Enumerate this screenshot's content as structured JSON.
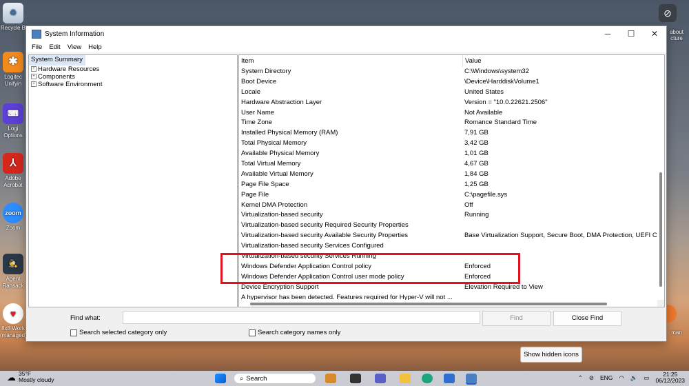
{
  "desktop": {
    "left_icons": [
      "Recycle B",
      "Logitec Unifyin",
      "Logi Options",
      "Adobe Acrobat",
      "Zoom",
      "Agent Ransack",
      "8x8 Work (managed)"
    ],
    "right_labels": [
      "about cture",
      "man"
    ],
    "zoom_icon_text": "zoom"
  },
  "window": {
    "title": "System Information",
    "controls": {
      "minimize": "─",
      "maximize": "☐",
      "close": "✕"
    },
    "menu": [
      "File",
      "Edit",
      "View",
      "Help"
    ],
    "tree": {
      "root": "System Summary",
      "children": [
        "Hardware Resources",
        "Components",
        "Software Environment"
      ]
    },
    "table": {
      "headers": {
        "item": "Item",
        "value": "Value"
      },
      "rows": [
        {
          "item": "System Directory",
          "value": "C:\\Windows\\system32"
        },
        {
          "item": "Boot Device",
          "value": "\\Device\\HarddiskVolume1"
        },
        {
          "item": "Locale",
          "value": "United States"
        },
        {
          "item": "Hardware Abstraction Layer",
          "value": "Version = \"10.0.22621.2506\""
        },
        {
          "item": "User Name",
          "value": "Not Available"
        },
        {
          "item": "Time Zone",
          "value": "Romance Standard Time"
        },
        {
          "item": "Installed Physical Memory (RAM)",
          "value": "7,91 GB"
        },
        {
          "item": "Total Physical Memory",
          "value": "3,42 GB"
        },
        {
          "item": "Available Physical Memory",
          "value": "1,01 GB"
        },
        {
          "item": "Total Virtual Memory",
          "value": "4,67 GB"
        },
        {
          "item": "Available Virtual Memory",
          "value": "1,84 GB"
        },
        {
          "item": "Page File Space",
          "value": "1,25 GB"
        },
        {
          "item": "Page File",
          "value": "C:\\pagefile.sys"
        },
        {
          "item": "Kernel DMA Protection",
          "value": "Off"
        },
        {
          "item": "Virtualization-based security",
          "value": "Running"
        },
        {
          "item": "Virtualization-based security Required Security Properties",
          "value": ""
        },
        {
          "item": "Virtualization-based security Available Security Properties",
          "value": "Base Virtualization Support, Secure Boot, DMA Protection, UEFI Co"
        },
        {
          "item": "Virtualization-based security Services Configured",
          "value": ""
        },
        {
          "item": "Virtualization-based security Services Running",
          "value": ""
        },
        {
          "item": "Windows Defender Application Control policy",
          "value": "Enforced"
        },
        {
          "item": "Windows Defender Application Control user mode policy",
          "value": "Enforced"
        },
        {
          "item": "Device Encryption Support",
          "value": "Elevation Required to View"
        },
        {
          "item": "A hypervisor has been detected. Features required for Hyper-V will not ...",
          "value": ""
        }
      ]
    },
    "find": {
      "label": "Find what:",
      "value": "",
      "find_button": "Find",
      "close_find_button": "Close Find",
      "search_selected_category": "Search selected category only",
      "search_category_names": "Search category names only"
    }
  },
  "tooltip": "Show hidden icons",
  "taskbar": {
    "weather_temp": "35°F",
    "weather_desc": "Mostly cloudy",
    "search_placeholder": "Search",
    "language": "ENG",
    "time": "21:25",
    "date": "06/12/2023"
  },
  "colors": {
    "highlight_box": "#e0141e",
    "selection": "#dbe7f6"
  }
}
